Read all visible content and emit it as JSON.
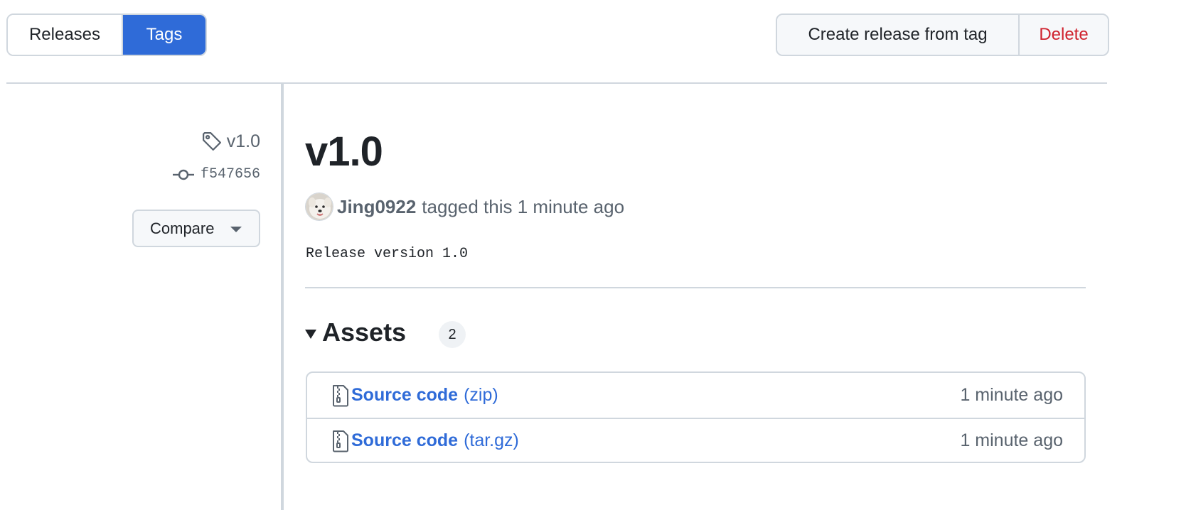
{
  "nav": {
    "releases_label": "Releases",
    "tags_label": "Tags",
    "active_tab": "Tags"
  },
  "actions": {
    "create_label": "Create release from tag",
    "delete_label": "Delete"
  },
  "meta": {
    "tag": "v1.0",
    "tag_icon": "tag-icon",
    "commit": "f547656",
    "commit_icon": "git-commit-icon",
    "compare_label": "Compare"
  },
  "release": {
    "title": "v1.0",
    "author": "Jing0922",
    "tagged_text": "tagged this 1 minute ago",
    "body": "Release version 1.0"
  },
  "assets": {
    "title": "Assets",
    "count": "2",
    "items": [
      {
        "name": "Source code",
        "ext": "(zip)",
        "time": "1 minute ago",
        "icon": "file-zip-icon"
      },
      {
        "name": "Source code",
        "ext": "(tar.gz)",
        "time": "1 minute ago",
        "icon": "file-zip-icon"
      }
    ]
  },
  "colors": {
    "accent": "#2f6bd8",
    "danger": "#cf222e",
    "border": "#d0d7de",
    "muted": "#59636e"
  }
}
